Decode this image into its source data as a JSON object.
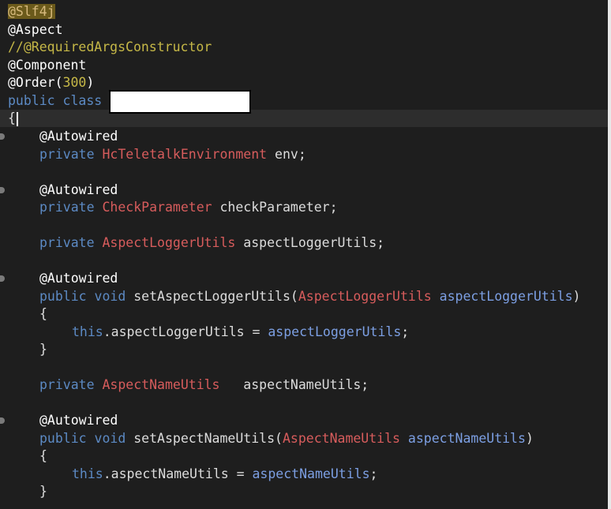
{
  "editor": {
    "lines": {
      "l1": {
        "a": "@Slf4j"
      },
      "l2": {
        "a": "@Aspect"
      },
      "l3": {
        "a": "//@RequiredArgsConstructor"
      },
      "l4": {
        "a": "@Component"
      },
      "l5": {
        "a": "@Order(",
        "b": "300",
        "c": ")"
      },
      "l6": {
        "a": "public class"
      },
      "l7": {
        "a": "{"
      },
      "l8": {
        "a": "@Autowired"
      },
      "l9": {
        "kw": "private",
        "type": "HcTeletalkEnvironment",
        "rest": " env;"
      },
      "l10": {
        "a": "@Autowired"
      },
      "l11": {
        "kw": "private",
        "type": "CheckParameter",
        "rest": " checkParameter;"
      },
      "l12": {
        "kw": "private",
        "type": "AspectLoggerUtils",
        "rest": " aspectLoggerUtils;"
      },
      "l13": {
        "a": "@Autowired"
      },
      "l14": {
        "kw": "public void",
        "name": " setAspectLoggerUtils(",
        "type": "AspectLoggerUtils",
        "param": " aspectLoggerUtils",
        "end": ")"
      },
      "l15": {
        "a": "{"
      },
      "l16": {
        "kw": "this",
        "mid": ".aspectLoggerUtils = ",
        "param": "aspectLoggerUtils",
        "end": ";"
      },
      "l17": {
        "a": "}"
      },
      "l18": {
        "kw": "private",
        "type": "AspectNameUtils",
        "rest": "   aspectNameUtils;"
      },
      "l19": {
        "a": "@Autowired"
      },
      "l20": {
        "kw": "public void",
        "name": " setAspectNameUtils(",
        "type": "AspectNameUtils",
        "param": " aspectNameUtils",
        "end": ")"
      },
      "l21": {
        "a": "{"
      },
      "l22": {
        "kw": "this",
        "mid": ".aspectNameUtils = ",
        "param": "aspectNameUtils",
        "end": ";"
      },
      "l23": {
        "a": "}"
      }
    }
  },
  "colors": {
    "background": "#1e1e1e",
    "keyword": "#5c8ac4",
    "type": "#d75c5c",
    "parameter": "#7c9fe3",
    "comment": "#c6b847",
    "annotation": "#ffffff"
  }
}
